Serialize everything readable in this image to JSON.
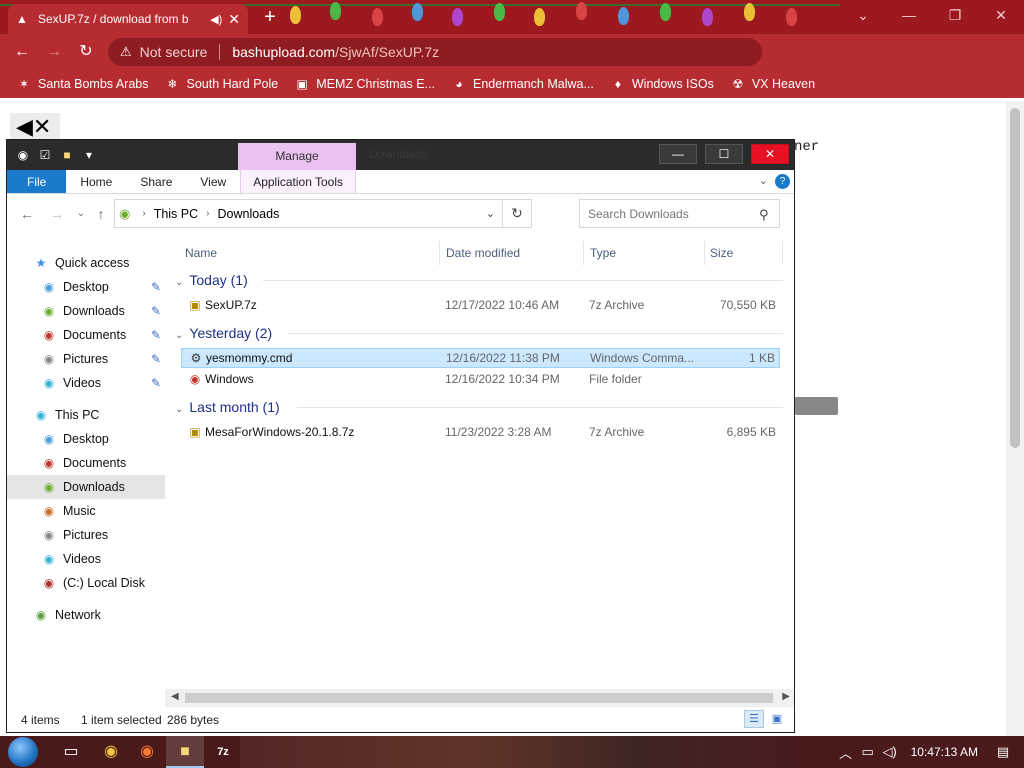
{
  "browser": {
    "tab_title": "SexUP.7z / download from b",
    "tab_favicon": "fire-icon",
    "new_tab_label": "+",
    "omnibox": {
      "security_label": "Not secure",
      "url_host": "bashupload.com",
      "url_path": "/SjwAf/SexUP.7z"
    },
    "bookmarks": [
      {
        "label": "Santa Bombs Arabs",
        "icon": "santa-icon"
      },
      {
        "label": "South Hard Pole",
        "icon": "snowflake-icon"
      },
      {
        "label": "MEMZ Christmas E...",
        "icon": "window-icon"
      },
      {
        "label": "Endermanch Malwa...",
        "icon": "raccoon-icon"
      },
      {
        "label": "Windows ISOs",
        "icon": "gnome-icon"
      },
      {
        "label": "VX Heaven",
        "icon": "vx-icon"
      }
    ]
  },
  "page": {
    "partial_text": "ner"
  },
  "explorer": {
    "title_tab_manage": "Manage",
    "title_text": "Downloads",
    "ribbon": {
      "tabs": [
        "File",
        "Home",
        "Share",
        "View",
        "Application Tools"
      ]
    },
    "breadcrumb": [
      "This PC",
      "Downloads"
    ],
    "search_placeholder": "Search Downloads",
    "nav": {
      "quick_access_label": "Quick access",
      "quick_access_items": [
        "Desktop",
        "Downloads",
        "Documents",
        "Pictures",
        "Videos"
      ],
      "this_pc_label": "This PC",
      "this_pc_items": [
        "Desktop",
        "Documents",
        "Downloads",
        "Music",
        "Pictures",
        "Videos",
        "(C:) Local Disk"
      ],
      "network_label": "Network"
    },
    "columns": {
      "name": "Name",
      "date": "Date modified",
      "type": "Type",
      "size": "Size"
    },
    "groups": {
      "today": "Today (1)",
      "yesterday": "Yesterday (2)",
      "last_month": "Last month (1)"
    },
    "files": {
      "sexup": {
        "name": "SexUP.7z",
        "date": "12/17/2022 10:46 AM",
        "type": "7z Archive",
        "size": "70,550 KB"
      },
      "yesmommy": {
        "name": "yesmommy.cmd",
        "date": "12/16/2022 11:38 PM",
        "type": "Windows Comma...",
        "size": "1 KB"
      },
      "windows": {
        "name": "Windows",
        "date": "12/16/2022 10:34 PM",
        "type": "File folder",
        "size": ""
      },
      "mesa": {
        "name": "MesaForWindows-20.1.8.7z",
        "date": "11/23/2022 3:28 AM",
        "type": "7z Archive",
        "size": "6,895 KB"
      }
    },
    "status": {
      "item_count": "4 items",
      "selection": "1 item selected",
      "selection_size": "286 bytes"
    }
  },
  "taskbar": {
    "clock": "10:47:13 AM",
    "apps": [
      "task-view-icon",
      "chrome-icon",
      "firefox-icon",
      "file-explorer-icon",
      "7zip-icon"
    ]
  }
}
